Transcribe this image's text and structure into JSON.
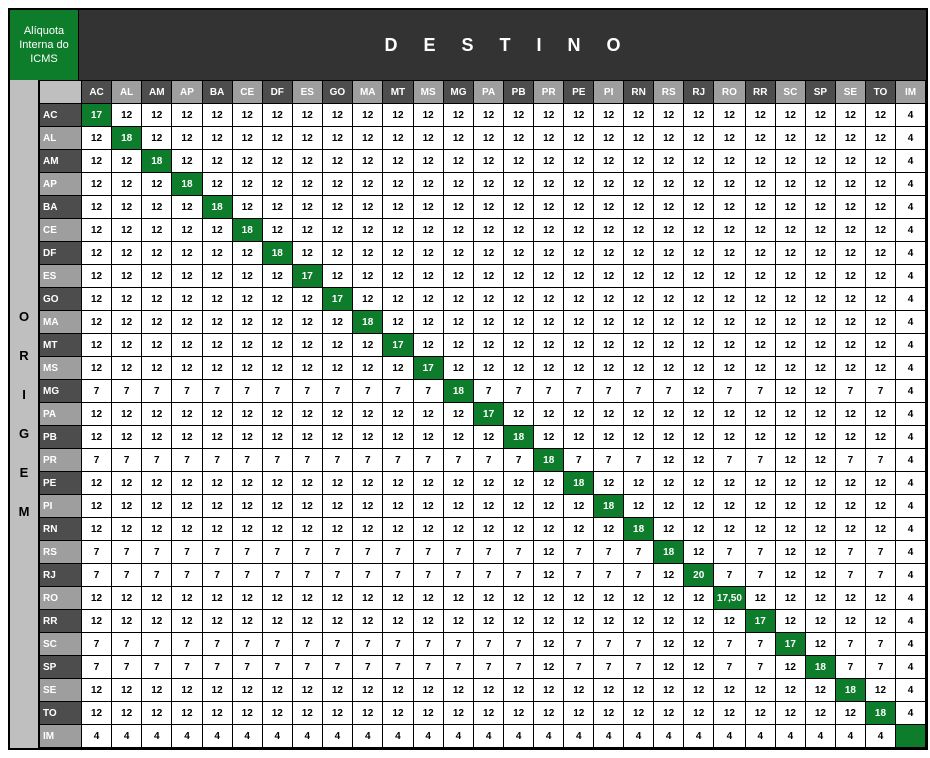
{
  "cornerLabel": "Alíquota Interna do ICMS",
  "destinoLabel": "DESTINO",
  "origemLetters": [
    "O",
    "R",
    "I",
    "G",
    "E",
    "M"
  ],
  "states": [
    "AC",
    "AL",
    "AM",
    "AP",
    "BA",
    "CE",
    "DF",
    "ES",
    "GO",
    "MA",
    "MT",
    "MS",
    "MG",
    "PA",
    "PB",
    "PR",
    "PE",
    "PI",
    "RN",
    "RS",
    "RJ",
    "RO",
    "RR",
    "SC",
    "SP",
    "SE",
    "TO",
    "IM"
  ],
  "altCols": [
    1,
    3,
    5,
    7,
    9,
    11,
    13,
    15,
    17,
    19,
    21,
    23,
    25,
    27
  ],
  "altRows": [
    1,
    3,
    5,
    7,
    9,
    11,
    13,
    15,
    17,
    19,
    21,
    23,
    25,
    27
  ],
  "matrix": [
    [
      "17",
      "12",
      "12",
      "12",
      "12",
      "12",
      "12",
      "12",
      "12",
      "12",
      "12",
      "12",
      "12",
      "12",
      "12",
      "12",
      "12",
      "12",
      "12",
      "12",
      "12",
      "12",
      "12",
      "12",
      "12",
      "12",
      "12",
      "4"
    ],
    [
      "12",
      "18",
      "12",
      "12",
      "12",
      "12",
      "12",
      "12",
      "12",
      "12",
      "12",
      "12",
      "12",
      "12",
      "12",
      "12",
      "12",
      "12",
      "12",
      "12",
      "12",
      "12",
      "12",
      "12",
      "12",
      "12",
      "12",
      "4"
    ],
    [
      "12",
      "12",
      "18",
      "12",
      "12",
      "12",
      "12",
      "12",
      "12",
      "12",
      "12",
      "12",
      "12",
      "12",
      "12",
      "12",
      "12",
      "12",
      "12",
      "12",
      "12",
      "12",
      "12",
      "12",
      "12",
      "12",
      "12",
      "4"
    ],
    [
      "12",
      "12",
      "12",
      "18",
      "12",
      "12",
      "12",
      "12",
      "12",
      "12",
      "12",
      "12",
      "12",
      "12",
      "12",
      "12",
      "12",
      "12",
      "12",
      "12",
      "12",
      "12",
      "12",
      "12",
      "12",
      "12",
      "12",
      "4"
    ],
    [
      "12",
      "12",
      "12",
      "12",
      "18",
      "12",
      "12",
      "12",
      "12",
      "12",
      "12",
      "12",
      "12",
      "12",
      "12",
      "12",
      "12",
      "12",
      "12",
      "12",
      "12",
      "12",
      "12",
      "12",
      "12",
      "12",
      "12",
      "4"
    ],
    [
      "12",
      "12",
      "12",
      "12",
      "12",
      "18",
      "12",
      "12",
      "12",
      "12",
      "12",
      "12",
      "12",
      "12",
      "12",
      "12",
      "12",
      "12",
      "12",
      "12",
      "12",
      "12",
      "12",
      "12",
      "12",
      "12",
      "12",
      "4"
    ],
    [
      "12",
      "12",
      "12",
      "12",
      "12",
      "12",
      "18",
      "12",
      "12",
      "12",
      "12",
      "12",
      "12",
      "12",
      "12",
      "12",
      "12",
      "12",
      "12",
      "12",
      "12",
      "12",
      "12",
      "12",
      "12",
      "12",
      "12",
      "4"
    ],
    [
      "12",
      "12",
      "12",
      "12",
      "12",
      "12",
      "12",
      "17",
      "12",
      "12",
      "12",
      "12",
      "12",
      "12",
      "12",
      "12",
      "12",
      "12",
      "12",
      "12",
      "12",
      "12",
      "12",
      "12",
      "12",
      "12",
      "12",
      "4"
    ],
    [
      "12",
      "12",
      "12",
      "12",
      "12",
      "12",
      "12",
      "12",
      "17",
      "12",
      "12",
      "12",
      "12",
      "12",
      "12",
      "12",
      "12",
      "12",
      "12",
      "12",
      "12",
      "12",
      "12",
      "12",
      "12",
      "12",
      "12",
      "4"
    ],
    [
      "12",
      "12",
      "12",
      "12",
      "12",
      "12",
      "12",
      "12",
      "12",
      "18",
      "12",
      "12",
      "12",
      "12",
      "12",
      "12",
      "12",
      "12",
      "12",
      "12",
      "12",
      "12",
      "12",
      "12",
      "12",
      "12",
      "12",
      "4"
    ],
    [
      "12",
      "12",
      "12",
      "12",
      "12",
      "12",
      "12",
      "12",
      "12",
      "12",
      "17",
      "12",
      "12",
      "12",
      "12",
      "12",
      "12",
      "12",
      "12",
      "12",
      "12",
      "12",
      "12",
      "12",
      "12",
      "12",
      "12",
      "4"
    ],
    [
      "12",
      "12",
      "12",
      "12",
      "12",
      "12",
      "12",
      "12",
      "12",
      "12",
      "12",
      "17",
      "12",
      "12",
      "12",
      "12",
      "12",
      "12",
      "12",
      "12",
      "12",
      "12",
      "12",
      "12",
      "12",
      "12",
      "12",
      "4"
    ],
    [
      "7",
      "7",
      "7",
      "7",
      "7",
      "7",
      "7",
      "7",
      "7",
      "7",
      "7",
      "7",
      "18",
      "7",
      "7",
      "7",
      "7",
      "7",
      "7",
      "7",
      "12",
      "7",
      "7",
      "12",
      "12",
      "7",
      "7",
      "4"
    ],
    [
      "12",
      "12",
      "12",
      "12",
      "12",
      "12",
      "12",
      "12",
      "12",
      "12",
      "12",
      "12",
      "12",
      "17",
      "12",
      "12",
      "12",
      "12",
      "12",
      "12",
      "12",
      "12",
      "12",
      "12",
      "12",
      "12",
      "12",
      "4"
    ],
    [
      "12",
      "12",
      "12",
      "12",
      "12",
      "12",
      "12",
      "12",
      "12",
      "12",
      "12",
      "12",
      "12",
      "12",
      "18",
      "12",
      "12",
      "12",
      "12",
      "12",
      "12",
      "12",
      "12",
      "12",
      "12",
      "12",
      "12",
      "4"
    ],
    [
      "7",
      "7",
      "7",
      "7",
      "7",
      "7",
      "7",
      "7",
      "7",
      "7",
      "7",
      "7",
      "7",
      "7",
      "7",
      "18",
      "7",
      "7",
      "7",
      "12",
      "12",
      "7",
      "7",
      "12",
      "12",
      "7",
      "7",
      "4"
    ],
    [
      "12",
      "12",
      "12",
      "12",
      "12",
      "12",
      "12",
      "12",
      "12",
      "12",
      "12",
      "12",
      "12",
      "12",
      "12",
      "12",
      "18",
      "12",
      "12",
      "12",
      "12",
      "12",
      "12",
      "12",
      "12",
      "12",
      "12",
      "4"
    ],
    [
      "12",
      "12",
      "12",
      "12",
      "12",
      "12",
      "12",
      "12",
      "12",
      "12",
      "12",
      "12",
      "12",
      "12",
      "12",
      "12",
      "12",
      "18",
      "12",
      "12",
      "12",
      "12",
      "12",
      "12",
      "12",
      "12",
      "12",
      "4"
    ],
    [
      "12",
      "12",
      "12",
      "12",
      "12",
      "12",
      "12",
      "12",
      "12",
      "12",
      "12",
      "12",
      "12",
      "12",
      "12",
      "12",
      "12",
      "12",
      "18",
      "12",
      "12",
      "12",
      "12",
      "12",
      "12",
      "12",
      "12",
      "4"
    ],
    [
      "7",
      "7",
      "7",
      "7",
      "7",
      "7",
      "7",
      "7",
      "7",
      "7",
      "7",
      "7",
      "7",
      "7",
      "7",
      "12",
      "7",
      "7",
      "7",
      "18",
      "12",
      "7",
      "7",
      "12",
      "12",
      "7",
      "7",
      "4"
    ],
    [
      "7",
      "7",
      "7",
      "7",
      "7",
      "7",
      "7",
      "7",
      "7",
      "7",
      "7",
      "7",
      "7",
      "7",
      "7",
      "12",
      "7",
      "7",
      "7",
      "12",
      "20",
      "7",
      "7",
      "12",
      "12",
      "7",
      "7",
      "4"
    ],
    [
      "12",
      "12",
      "12",
      "12",
      "12",
      "12",
      "12",
      "12",
      "12",
      "12",
      "12",
      "12",
      "12",
      "12",
      "12",
      "12",
      "12",
      "12",
      "12",
      "12",
      "12",
      "17,50",
      "12",
      "12",
      "12",
      "12",
      "12",
      "4"
    ],
    [
      "12",
      "12",
      "12",
      "12",
      "12",
      "12",
      "12",
      "12",
      "12",
      "12",
      "12",
      "12",
      "12",
      "12",
      "12",
      "12",
      "12",
      "12",
      "12",
      "12",
      "12",
      "12",
      "17",
      "12",
      "12",
      "12",
      "12",
      "4"
    ],
    [
      "7",
      "7",
      "7",
      "7",
      "7",
      "7",
      "7",
      "7",
      "7",
      "7",
      "7",
      "7",
      "7",
      "7",
      "7",
      "12",
      "7",
      "7",
      "7",
      "12",
      "12",
      "7",
      "7",
      "17",
      "12",
      "7",
      "7",
      "4"
    ],
    [
      "7",
      "7",
      "7",
      "7",
      "7",
      "7",
      "7",
      "7",
      "7",
      "7",
      "7",
      "7",
      "7",
      "7",
      "7",
      "12",
      "7",
      "7",
      "7",
      "12",
      "12",
      "7",
      "7",
      "12",
      "18",
      "7",
      "7",
      "4"
    ],
    [
      "12",
      "12",
      "12",
      "12",
      "12",
      "12",
      "12",
      "12",
      "12",
      "12",
      "12",
      "12",
      "12",
      "12",
      "12",
      "12",
      "12",
      "12",
      "12",
      "12",
      "12",
      "12",
      "12",
      "12",
      "12",
      "18",
      "12",
      "4"
    ],
    [
      "12",
      "12",
      "12",
      "12",
      "12",
      "12",
      "12",
      "12",
      "12",
      "12",
      "12",
      "12",
      "12",
      "12",
      "12",
      "12",
      "12",
      "12",
      "12",
      "12",
      "12",
      "12",
      "12",
      "12",
      "12",
      "12",
      "18",
      "4"
    ],
    [
      "4",
      "4",
      "4",
      "4",
      "4",
      "4",
      "4",
      "4",
      "4",
      "4",
      "4",
      "4",
      "4",
      "4",
      "4",
      "4",
      "4",
      "4",
      "4",
      "4",
      "4",
      "4",
      "4",
      "4",
      "4",
      "4",
      "4",
      ""
    ]
  ],
  "diagLastGreen": true
}
